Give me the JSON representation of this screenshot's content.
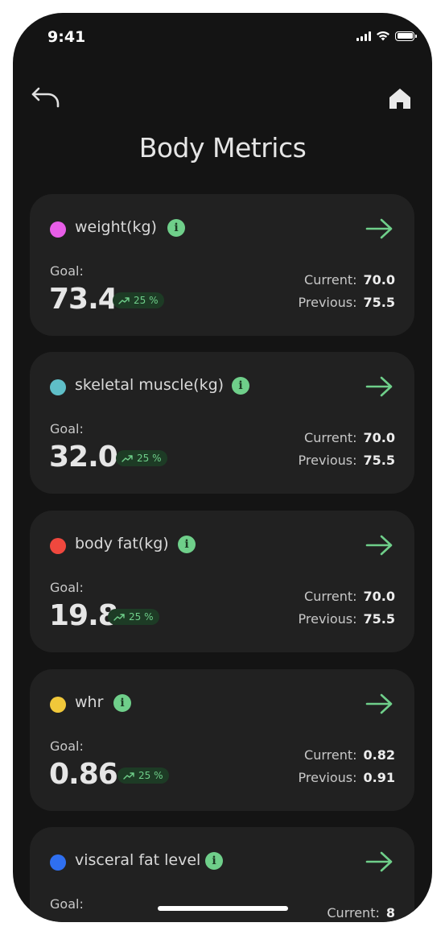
{
  "status": {
    "time": "9:41"
  },
  "page": {
    "title": "Body Metrics"
  },
  "labels": {
    "goal": "Goal:",
    "current": "Current:",
    "previous": "Previous:"
  },
  "metrics": [
    {
      "name": "weight(kg)",
      "color": "#e85ee8",
      "goal": "73.4",
      "change": "25 %",
      "current": "70.0",
      "previous": "75.5"
    },
    {
      "name": "skeletal muscle(kg)",
      "color": "#5fbfc8",
      "goal": "32.0",
      "change": "25 %",
      "current": "70.0",
      "previous": "75.5"
    },
    {
      "name": "body fat(kg)",
      "color": "#f0483e",
      "goal": "19.8",
      "change": "25 %",
      "current": "70.0",
      "previous": "75.5"
    },
    {
      "name": "whr",
      "color": "#f1c83a",
      "goal": "0.86",
      "change": "25 %",
      "current": "0.82",
      "previous": "0.91"
    },
    {
      "name": "visceral fat level",
      "color": "#2f6ff0",
      "goal": "",
      "change": "",
      "current": "8",
      "previous": ""
    }
  ],
  "colors": {
    "accent": "#6fcf8a",
    "background": "#141414",
    "card": "#212121"
  }
}
